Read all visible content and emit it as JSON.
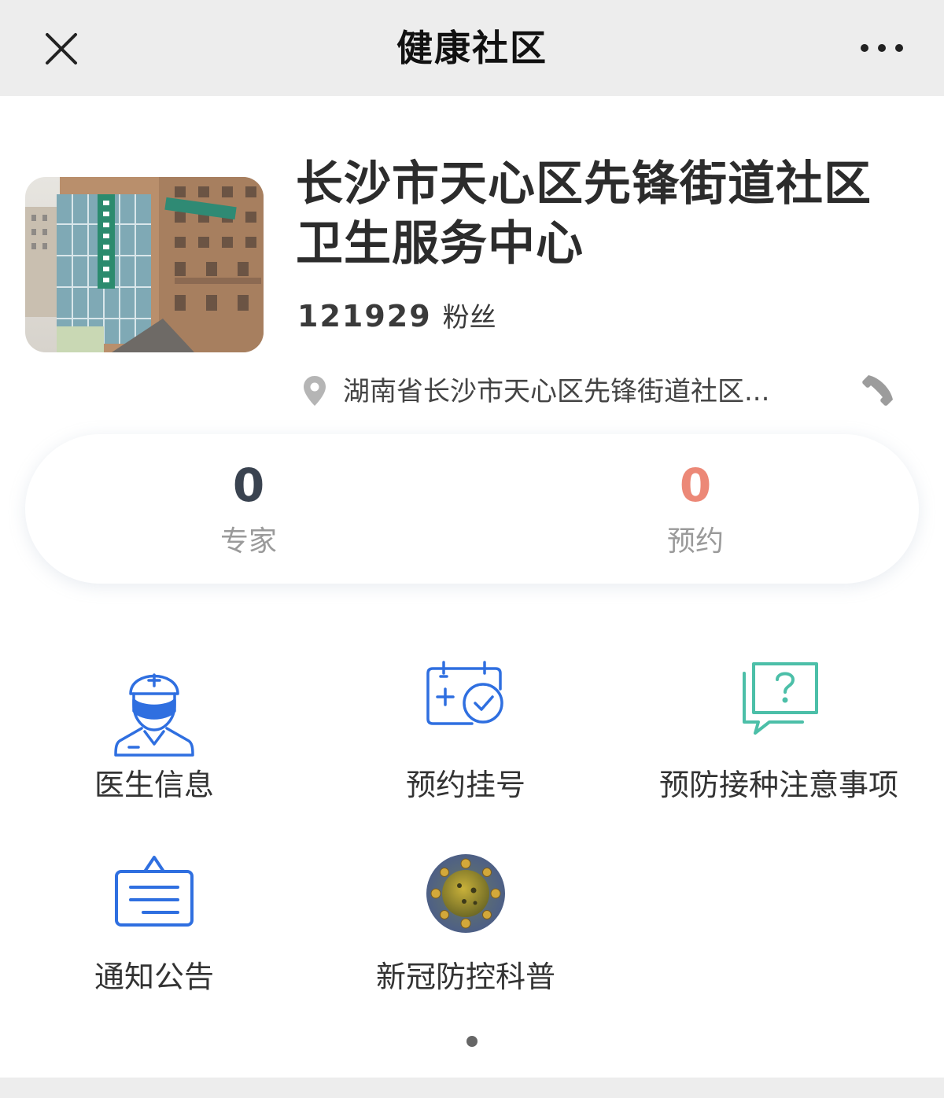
{
  "navbar": {
    "title": "健康社区",
    "close_icon": "close-icon",
    "more_icon": "more-dots-icon"
  },
  "header": {
    "photo": "building-photo",
    "name": "长沙市天心区先锋街道社区卫生服务中心",
    "fans_count": "121929",
    "fans_label": "粉丝",
    "address": "湖南省长沙市天心区先锋街道社区...",
    "pin_icon": "location-pin-icon",
    "phone_icon": "phone-icon"
  },
  "stats": {
    "experts": {
      "value": "0",
      "label": "专家",
      "color": "#3a4350"
    },
    "appointments": {
      "value": "0",
      "label": "预约",
      "color": "#ec8877"
    }
  },
  "grid": {
    "items": [
      {
        "label": "医生信息",
        "icon": "doctor-icon"
      },
      {
        "label": "预约挂号",
        "icon": "calendar-check-icon"
      },
      {
        "label": "预防接种注意事项",
        "icon": "question-chat-icon"
      },
      {
        "label": "通知公告",
        "icon": "notice-board-icon"
      },
      {
        "label": "新冠防控科普",
        "icon": "virus-icon"
      }
    ]
  },
  "colors": {
    "accent_blue": "#2f6fe0",
    "accent_teal": "#4cbfa8",
    "navbar_bg": "#ededed"
  }
}
